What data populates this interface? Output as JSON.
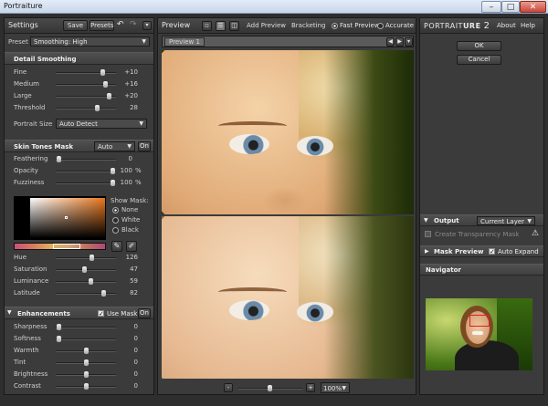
{
  "window": {
    "title": "Portraiture",
    "minimize": "–",
    "maximize": "□",
    "close": "✕"
  },
  "left": {
    "header": {
      "title": "Settings",
      "save": "Save",
      "presets": "Presets"
    },
    "preset": {
      "label": "Preset",
      "value": "Smoothing: High"
    },
    "detail": {
      "title": "Detail Smoothing",
      "sliders": [
        {
          "label": "Fine",
          "value": "+10",
          "pos": 0.8
        },
        {
          "label": "Medium",
          "value": "+16",
          "pos": 0.86
        },
        {
          "label": "Large",
          "value": "+20",
          "pos": 0.92
        },
        {
          "label": "Threshold",
          "value": "28",
          "pos": 0.7
        }
      ],
      "portrait_size": {
        "label": "Portrait Size",
        "value": "Auto Detect"
      }
    },
    "skin": {
      "title": "Skin Tones Mask",
      "mode": "Auto",
      "on": "On",
      "sliders": [
        {
          "label": "Feathering",
          "value": "0",
          "unit": "",
          "pos": 0.02
        },
        {
          "label": "Opacity",
          "value": "100",
          "unit": "%",
          "pos": 0.98
        },
        {
          "label": "Fuzziness",
          "value": "100",
          "unit": "%",
          "pos": 0.98
        }
      ],
      "show_mask": {
        "label": "Show Mask:",
        "options": [
          "None",
          "White",
          "Black"
        ],
        "selected": 0
      },
      "hsl": [
        {
          "label": "Hue",
          "value": "126",
          "pos": 0.6
        },
        {
          "label": "Saturation",
          "value": "47",
          "pos": 0.47
        },
        {
          "label": "Luminance",
          "value": "59",
          "pos": 0.59
        },
        {
          "label": "Latitude",
          "value": "82",
          "pos": 0.82
        }
      ]
    },
    "enh": {
      "title": "Enhancements",
      "use_mask": "Use Mask",
      "on": "On",
      "sliders": [
        {
          "label": "Sharpness",
          "value": "0",
          "pos": 0.02
        },
        {
          "label": "Softness",
          "value": "0",
          "pos": 0.02
        },
        {
          "label": "Warmth",
          "value": "0",
          "pos": 0.5
        },
        {
          "label": "Tint",
          "value": "0",
          "pos": 0.5
        },
        {
          "label": "Brightness",
          "value": "0",
          "pos": 0.5
        },
        {
          "label": "Contrast",
          "value": "0",
          "pos": 0.5
        }
      ]
    }
  },
  "center": {
    "header": {
      "title": "Preview",
      "add_preview": "Add Preview",
      "bracketing": "Bracketing",
      "fast": "Fast Preview",
      "accurate": "Accurate"
    },
    "tab": "Preview 1",
    "zoom": "100%",
    "minus": "-",
    "plus": "+"
  },
  "right": {
    "logo_a": "PORTRAIT",
    "logo_b": "URE",
    "logo_v": "2",
    "about": "About",
    "help": "Help",
    "ok": "OK",
    "cancel": "Cancel",
    "output": {
      "title": "Output",
      "value": "Current Layer",
      "transparency": "Create Transparency Mask"
    },
    "mask_preview": {
      "title": "Mask Preview",
      "auto_expand": "Auto Expand"
    },
    "navigator": "Navigator"
  }
}
